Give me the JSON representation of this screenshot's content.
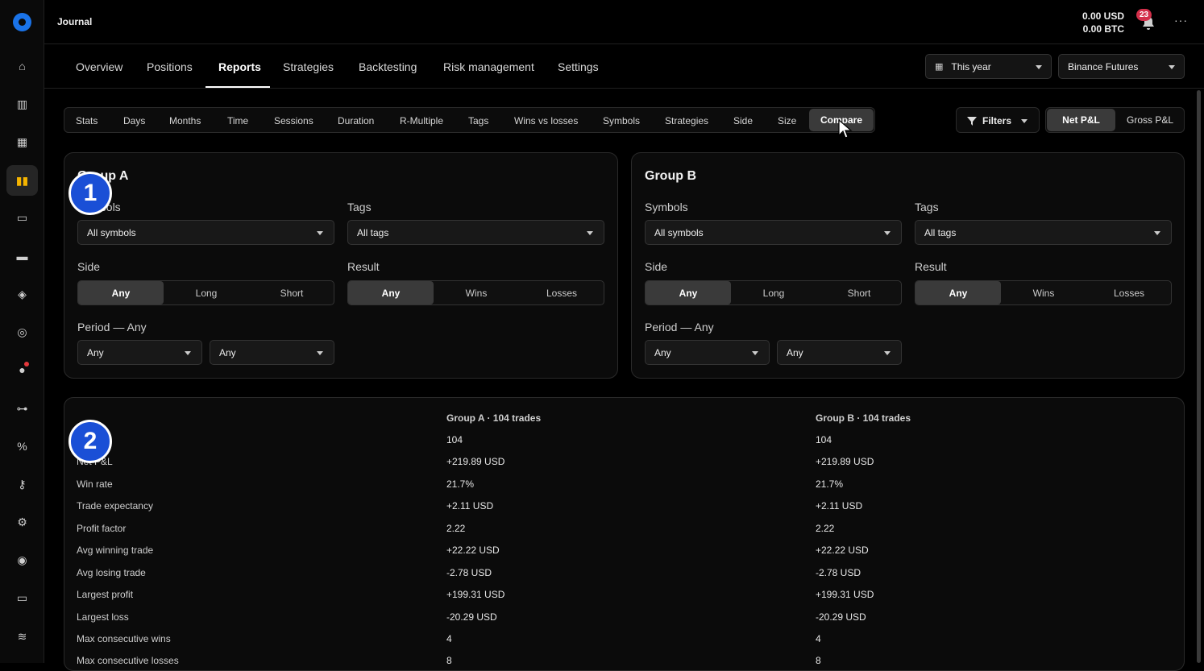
{
  "topbar": {
    "title": "Journal",
    "balance_usd": "0.00 USD",
    "balance_btc": "0.00 BTC",
    "notifications": "23",
    "more": "···"
  },
  "nav": {
    "tabs": [
      "Overview",
      "Positions",
      "Reports",
      "Strategies",
      "Backtesting",
      "Risk management",
      "Settings"
    ],
    "active": "Reports",
    "period": "This year",
    "exchange": "Binance Futures"
  },
  "subtabs": {
    "items": [
      "Stats",
      "Days",
      "Months",
      "Time",
      "Sessions",
      "Duration",
      "R-Multiple",
      "Tags",
      "Wins vs losses",
      "Symbols",
      "Strategies",
      "Side",
      "Size",
      "Compare"
    ],
    "active": "Compare",
    "filters": "Filters",
    "net": "Net P&L",
    "gross": "Gross P&L"
  },
  "groupA": {
    "title": "Group A",
    "symbols_label": "Symbols",
    "symbols_value": "All symbols",
    "tags_label": "Tags",
    "tags_value": "All tags",
    "side_label": "Side",
    "side_options": [
      "Any",
      "Long",
      "Short"
    ],
    "result_label": "Result",
    "result_options": [
      "Any",
      "Wins",
      "Losses"
    ],
    "period_label": "Period — Any",
    "period_from": "Any",
    "period_to": "Any"
  },
  "groupB": {
    "title": "Group B",
    "symbols_label": "Symbols",
    "symbols_value": "All symbols",
    "tags_label": "Tags",
    "tags_value": "All tags",
    "side_label": "Side",
    "side_options": [
      "Any",
      "Long",
      "Short"
    ],
    "result_label": "Result",
    "result_options": [
      "Any",
      "Wins",
      "Losses"
    ],
    "period_label": "Period — Any",
    "period_from": "Any",
    "period_to": "Any"
  },
  "stats": {
    "header_a": "Group A · 104 trades",
    "header_b": "Group B · 104 trades",
    "rows": [
      {
        "label": "",
        "a": "104",
        "b": "104"
      },
      {
        "label": "Net P&L",
        "a": "+219.89 USD",
        "b": "+219.89 USD"
      },
      {
        "label": "Win rate",
        "a": "21.7%",
        "b": "21.7%"
      },
      {
        "label": "Trade expectancy",
        "a": "+2.11 USD",
        "b": "+2.11 USD"
      },
      {
        "label": "Profit factor",
        "a": "2.22",
        "b": "2.22"
      },
      {
        "label": "Avg winning trade",
        "a": "+22.22 USD",
        "b": "+22.22 USD"
      },
      {
        "label": "Avg losing trade",
        "a": "-2.78 USD",
        "b": "-2.78 USD"
      },
      {
        "label": "Largest profit",
        "a": "+199.31 USD",
        "b": "+199.31 USD"
      },
      {
        "label": "Largest loss",
        "a": "-20.29 USD",
        "b": "-20.29 USD"
      },
      {
        "label": "Max consecutive wins",
        "a": "4",
        "b": "4"
      },
      {
        "label": "Max consecutive losses",
        "a": "8",
        "b": "8"
      }
    ]
  },
  "markers": [
    "1",
    "2"
  ],
  "colors": {
    "accent": "#1a4fd6",
    "badge": "#d32f4a",
    "active_icon": "#f5b400"
  },
  "sidebar_icons": [
    "home-icon",
    "chart-icon",
    "grid-icon",
    "book-icon",
    "ticket-icon",
    "wallet-icon",
    "tag-icon",
    "compass-icon",
    "chat-icon",
    "dumbbell-icon",
    "percent-icon",
    "key-icon",
    "gear-icon",
    "support-icon",
    "monitor-icon",
    "wifi-icon"
  ]
}
